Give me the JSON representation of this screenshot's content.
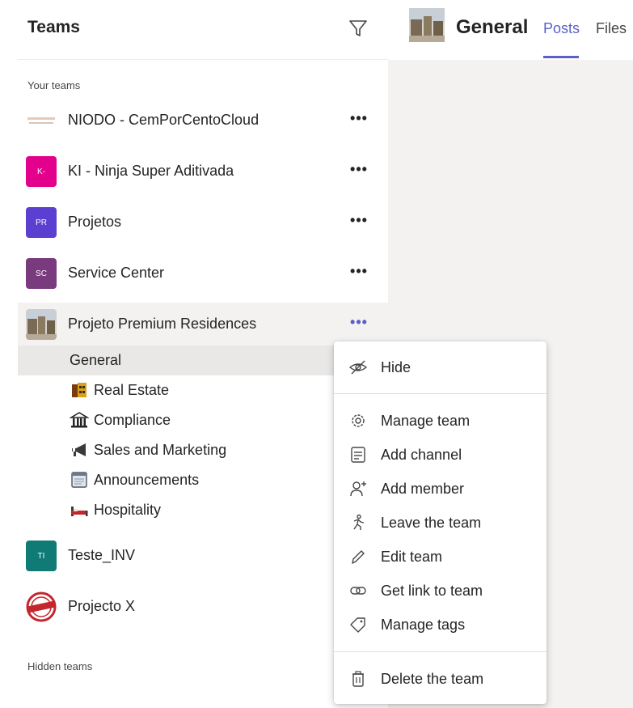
{
  "sidebar": {
    "title": "Teams",
    "your_teams_label": "Your teams",
    "hidden_teams_label": "Hidden teams",
    "more_label": "•••",
    "teams": [
      {
        "name": "NIODO - CemPorCentoCloud",
        "initials": "",
        "color": "#ffffff"
      },
      {
        "name": "KI - Ninja Super Aditivada",
        "initials": "K-",
        "color": "#e3008c"
      },
      {
        "name": "Projetos",
        "initials": "PR",
        "color": "#5b3fd0"
      },
      {
        "name": "Service Center",
        "initials": "SC",
        "color": "#7a3a7e"
      },
      {
        "name": "Projeto Premium Residences",
        "initials": "",
        "color": "#c8c6c4"
      },
      {
        "name": "Teste_INV",
        "initials": "TI",
        "color": "#0f7b74"
      },
      {
        "name": "Projecto X",
        "initials": "",
        "color": "#c4262e"
      }
    ],
    "channels": [
      {
        "name": "General",
        "icon": "none"
      },
      {
        "name": "Real Estate",
        "icon": "building-icon"
      },
      {
        "name": "Compliance",
        "icon": "bank-icon"
      },
      {
        "name": "Sales and Marketing",
        "icon": "megaphone-icon"
      },
      {
        "name": "Announcements",
        "icon": "notepad-icon"
      },
      {
        "name": "Hospitality",
        "icon": "bed-icon"
      }
    ]
  },
  "header": {
    "title": "General",
    "tabs": [
      "Posts",
      "Files"
    ]
  },
  "menu": {
    "items": [
      {
        "label": "Hide",
        "icon": "hide-icon"
      },
      {
        "label": "Manage team",
        "icon": "gear-icon"
      },
      {
        "label": "Add channel",
        "icon": "channel-icon"
      },
      {
        "label": "Add member",
        "icon": "add-person-icon"
      },
      {
        "label": "Leave the team",
        "icon": "walk-out-icon"
      },
      {
        "label": "Edit team",
        "icon": "pencil-icon"
      },
      {
        "label": "Get link to team",
        "icon": "link-icon"
      },
      {
        "label": "Manage tags",
        "icon": "tag-icon"
      },
      {
        "label": "Delete the team",
        "icon": "trash-icon"
      }
    ]
  },
  "colors": {
    "accent": "#5b5fc7",
    "content_background": "#f3f2f1"
  }
}
